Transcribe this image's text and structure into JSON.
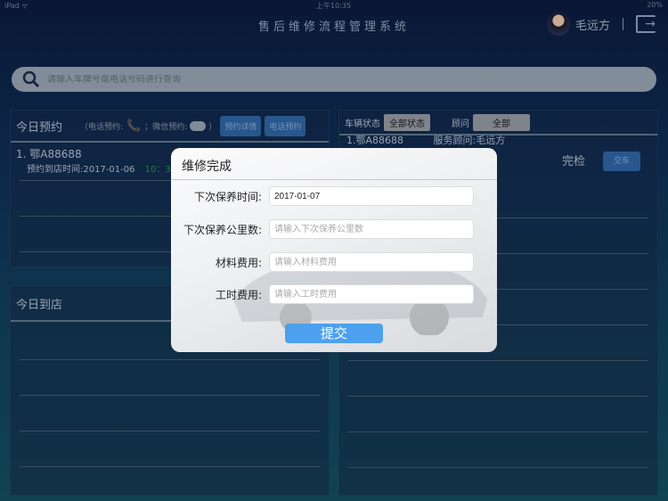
{
  "status_bar": {
    "device": "iPad ᯤ",
    "time": "上午10:35",
    "battery": "20%"
  },
  "header": {
    "title": "售后维修流程管理系统",
    "user_name": "毛远方"
  },
  "search": {
    "placeholder": "请输入车牌号或电话号码进行查询"
  },
  "appointments": {
    "title": "今日预约",
    "legend_phone": "（电话预约:",
    "legend_wechat": "；微信预约:",
    "legend_end": "）",
    "detail_button": "预约详情",
    "phone_button": "电话预约",
    "items": [
      {
        "plate": "1. 鄂A88688",
        "time_label": "预约到店时间:2017-01-06",
        "time": "10：30"
      }
    ]
  },
  "arrivals": {
    "title": "今日到店",
    "col": "到店"
  },
  "vehicles": {
    "status_label": "车辆状态",
    "status_value": "全部状态",
    "advisor_label": "顾问",
    "advisor_value": "全部",
    "items": [
      {
        "plate": "1.鄂A88688",
        "advisor": "服务顾问:毛远方",
        "state": "完检",
        "action": "交车"
      }
    ]
  },
  "modal": {
    "title": "维修完成",
    "fields": [
      {
        "label": "下次保养时间:",
        "value": "2017-01-07",
        "placeholder": ""
      },
      {
        "label": "下次保养公里数:",
        "value": "",
        "placeholder": "请输入下次保养公里数"
      },
      {
        "label": "材料费用:",
        "value": "",
        "placeholder": "请输入材料费用"
      },
      {
        "label": "工时费用:",
        "value": "",
        "placeholder": "请输入工时费用"
      }
    ],
    "submit": "提交"
  }
}
